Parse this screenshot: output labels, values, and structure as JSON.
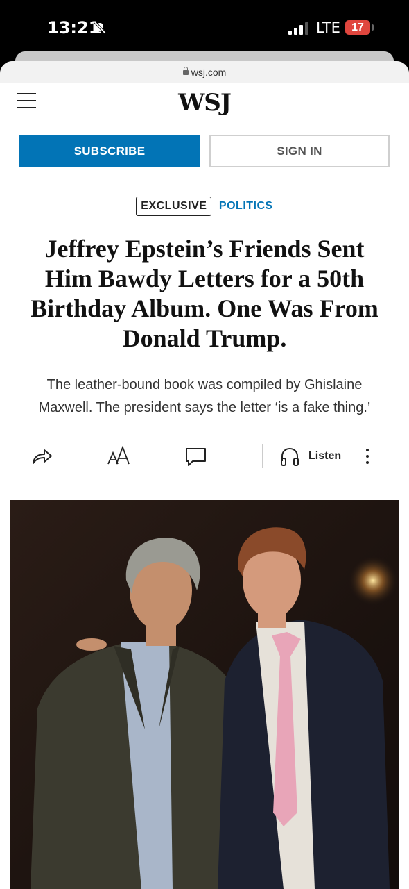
{
  "status": {
    "time": "13:21",
    "network": "LTE",
    "battery": "17"
  },
  "browser": {
    "url": "wsj.com"
  },
  "header": {
    "logo": "WSJ"
  },
  "actions": {
    "subscribe": "SUBSCRIBE",
    "sign_in": "SIGN IN"
  },
  "article": {
    "flag": "EXCLUSIVE",
    "section": "POLITICS",
    "headline": "Jeffrey Epstein’s Friends Sent Him Bawdy Letters for a 50th Birthday Album. One Was From Donald Trump.",
    "dek": "The leather-bound book was compiled by Ghislaine Maxwell. The president says the letter ‘is a fake thing.’"
  },
  "toolbar": {
    "listen": "Listen",
    "icons": [
      "share-icon",
      "text-size-icon",
      "comment-icon",
      "headphones-icon",
      "more-icon"
    ]
  },
  "colors": {
    "accent": "#0274b6",
    "battery": "#e0463e"
  }
}
